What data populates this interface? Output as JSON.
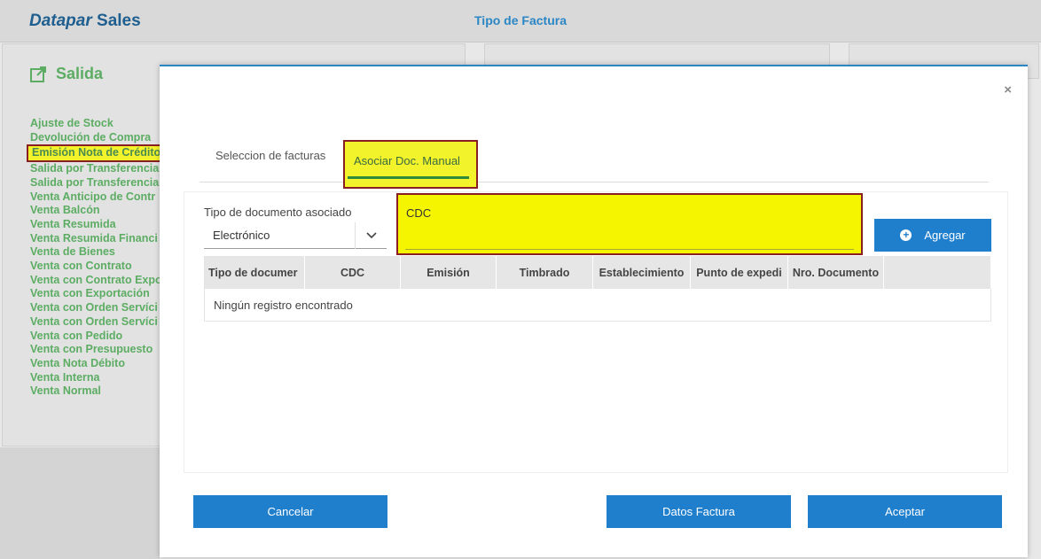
{
  "app": {
    "brand_italic": "Datapar",
    "brand_rest": " Sales",
    "page_title": "Tipo de Factura"
  },
  "sidebar": {
    "title": "Salida",
    "items": [
      "Ajuste de Stock",
      "Devolución de Compra",
      "Emisión Nota de Crédito",
      "Salida por Transferencia",
      "Salida por Transferencia",
      "Venta Anticipo de Contr",
      "Venta Balcón",
      "Venta Resumida",
      "Venta Resumida Financi",
      "Venta de Bienes",
      "Venta con Contrato",
      "Venta con Contrato Expo",
      "Venta con Exportación",
      "Venta con Orden Servíci",
      "Venta con Orden Servíci",
      "Venta con Pedido",
      "Venta con Presupuesto",
      "Venta Nota Débito",
      "Venta Interna",
      "Venta Normal"
    ],
    "active_index": 2
  },
  "modal": {
    "close": "×",
    "tabs": [
      "Seleccion de facturas",
      "Asociar Doc. Manual"
    ],
    "active_tab": 1,
    "doc_type_label": "Tipo de documento asociado",
    "doc_type_value": "Electrónico",
    "cdc_label": "CDC",
    "cdc_value": "",
    "add_button": "Agregar",
    "table": {
      "columns": [
        "Tipo de documer",
        "CDC",
        "Emisión",
        "Timbrado",
        "Establecimiento",
        "Punto de expedi",
        "Nro. Documento",
        ""
      ],
      "empty_message": "Ningún registro encontrado"
    },
    "buttons": {
      "cancel": "Cancelar",
      "datos": "Datos Factura",
      "accept": "Aceptar"
    }
  },
  "colors": {
    "accent": "#1f7fcd",
    "menu_green": "#5cad63",
    "highlight": "#f3f32c",
    "highlight_border": "#8a1f22"
  }
}
